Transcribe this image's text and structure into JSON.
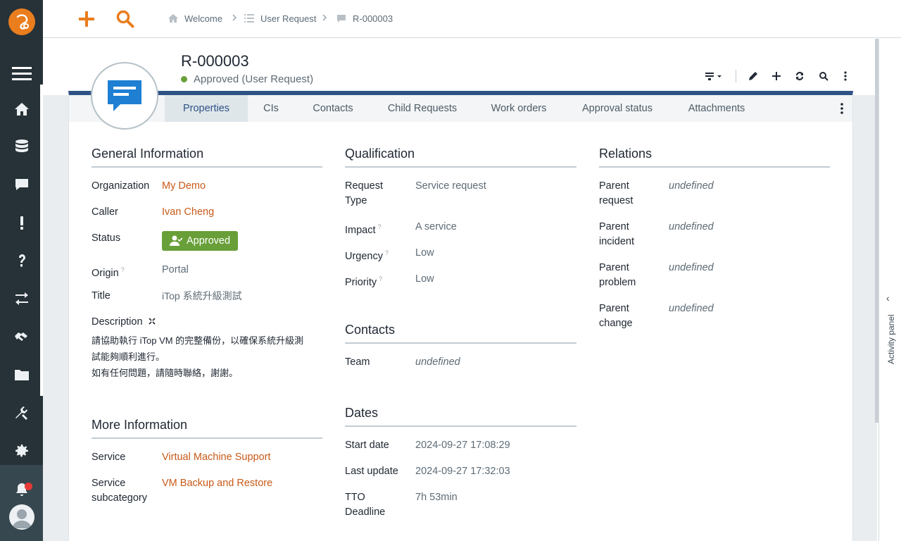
{
  "breadcrumb": [
    {
      "label": "Welcome",
      "icon": "home-icon"
    },
    {
      "label": "User Request",
      "icon": "list-icon"
    },
    {
      "label": "R-000003",
      "icon": "request-icon"
    }
  ],
  "object": {
    "ref": "R-000003",
    "status": "Approved",
    "class": "(User Request)",
    "status_color": "#689f38"
  },
  "tabs": [
    {
      "label": "Properties",
      "active": true
    },
    {
      "label": "CIs"
    },
    {
      "label": "Contacts"
    },
    {
      "label": "Child Requests"
    },
    {
      "label": "Work orders"
    },
    {
      "label": "Approval status"
    },
    {
      "label": "Attachments"
    }
  ],
  "general": {
    "title": "General Information",
    "organization_label": "Organization",
    "organization": "My Demo",
    "caller_label": "Caller",
    "caller": "Ivan Cheng",
    "status_label": "Status",
    "status": "Approved",
    "origin_label": "Origin",
    "origin": "Portal",
    "title_label": "Title",
    "title_value": "iTop 系統升級測試",
    "description_label": "Description",
    "description_line1": "請協助執行 iTop VM 的完整備份，以確保系統升級測",
    "description_line2": "試能夠順利進行。",
    "description_line3": "如有任何問題，請隨時聯絡，謝謝。"
  },
  "more": {
    "title": "More Information",
    "service_label": "Service",
    "service": "Virtual Machine Support",
    "subcat_label_1": "Service",
    "subcat_label_2": "subcategory",
    "subcat": "VM Backup and Restore"
  },
  "qualification": {
    "title": "Qualification",
    "request_type_label_1": "Request",
    "request_type_label_2": "Type",
    "request_type": "Service request",
    "impact_label": "Impact",
    "impact": "A service",
    "urgency_label": "Urgency",
    "urgency": "Low",
    "priority_label": "Priority",
    "priority": "Low"
  },
  "contacts": {
    "title": "Contacts",
    "team_label": "Team",
    "team": "undefined"
  },
  "dates": {
    "title": "Dates",
    "start_label": "Start date",
    "start": "2024-09-27 17:08:29",
    "update_label": "Last update",
    "update": "2024-09-27 17:32:03",
    "tto_label_1": "TTO",
    "tto_label_2": "Deadline",
    "tto": "7h 53min"
  },
  "relations": {
    "title": "Relations",
    "parent_request_1": "Parent",
    "parent_request_2": "request",
    "parent_request": "undefined",
    "parent_incident_1": "Parent",
    "parent_incident_2": "incident",
    "parent_incident": "undefined",
    "parent_problem_1": "Parent",
    "parent_problem_2": "problem",
    "parent_problem": "undefined",
    "parent_change_1": "Parent",
    "parent_change_2": "change",
    "parent_change": "undefined"
  },
  "hint_mark": "?",
  "activity_panel": "Activity panel",
  "colors": {
    "accent": "#ea7d1e",
    "sidebar": "#263238",
    "link": "#c85a17",
    "header_bar": "#2d5286"
  }
}
